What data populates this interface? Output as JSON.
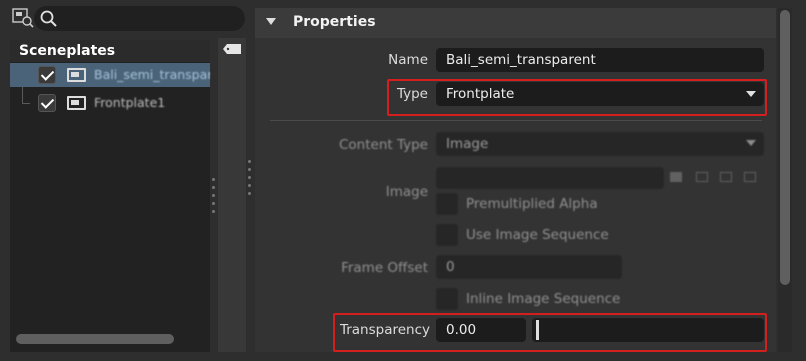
{
  "tree": {
    "title": "Sceneplates",
    "items": [
      {
        "label": "Bali_semi_transparent",
        "checked": true,
        "selected": true
      },
      {
        "label": "Frontplate1",
        "checked": true,
        "selected": false
      }
    ]
  },
  "search": {
    "placeholder": ""
  },
  "properties": {
    "title": "Properties",
    "name_label": "Name",
    "name_value": "Bali_semi_transparent",
    "type_label": "Type",
    "type_value": "Frontplate",
    "content_type_label": "Content Type",
    "content_type_value": "Image",
    "image_label": "Image",
    "image_value": "",
    "premultiplied_label": "Premultiplied Alpha",
    "use_sequence_label": "Use Image Sequence",
    "frame_offset_label": "Frame Offset",
    "frame_offset_value": "0",
    "inline_sequence_label": "Inline Image Sequence",
    "transparency_label": "Transparency",
    "transparency_value": "0.00",
    "transparency_slider": 0.0
  },
  "colors": {
    "highlight": "#d41f1f",
    "selection": "#4a6378"
  }
}
